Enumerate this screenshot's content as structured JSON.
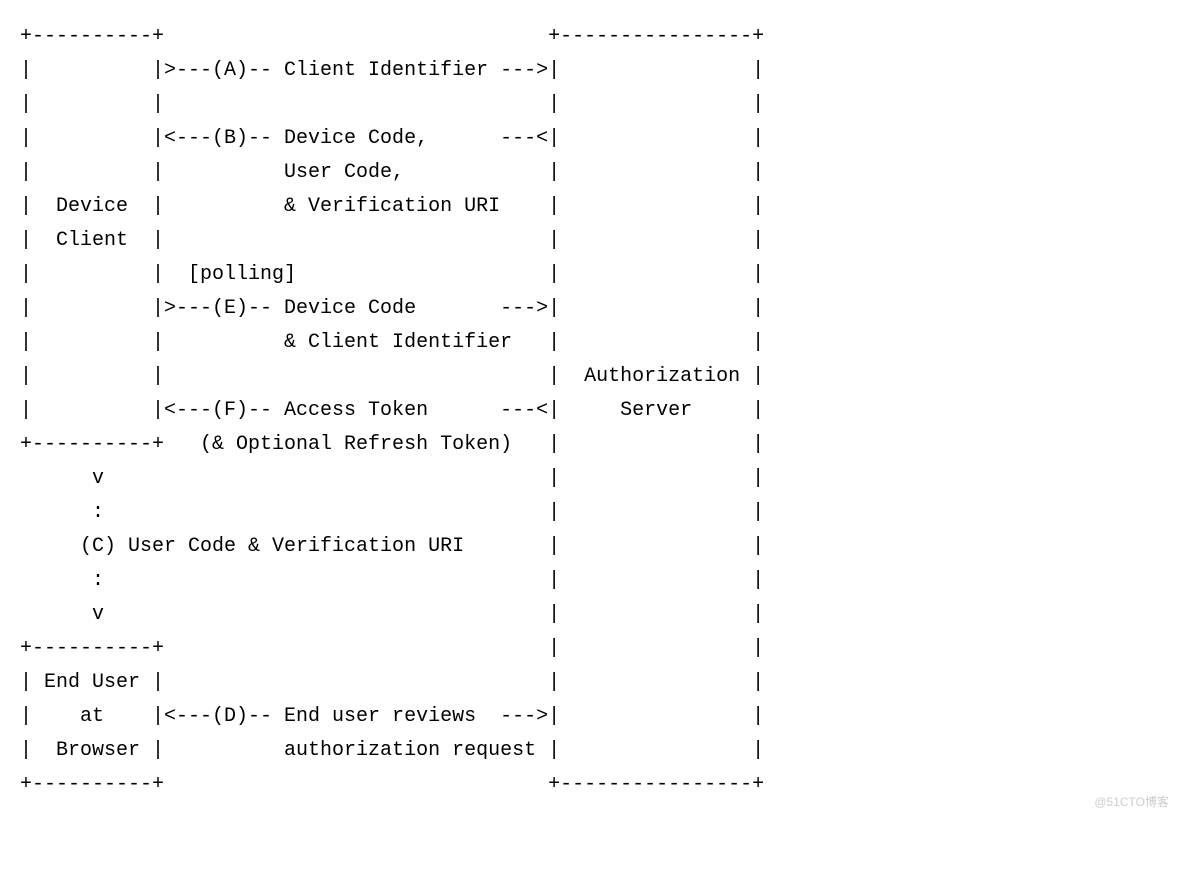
{
  "diagram": {
    "lines": [
      "+----------+                                +----------------+",
      "|          |>---(A)-- Client Identifier --->|                |",
      "|          |                                |                |",
      "|          |<---(B)-- Device Code,      ---<|                |",
      "|          |          User Code,            |                |",
      "|  Device  |          & Verification URI    |                |",
      "|  Client  |                                |                |",
      "|          |  [polling]                     |                |",
      "|          |>---(E)-- Device Code       --->|                |",
      "|          |          & Client Identifier   |                |",
      "|          |                                |  Authorization |",
      "|          |<---(F)-- Access Token      ---<|     Server     |",
      "+----------+   (& Optional Refresh Token)   |                |",
      "      v                                     |                |",
      "      :                                     |                |",
      "     (C) User Code & Verification URI       |                |",
      "      :                                     |                |",
      "      v                                     |                |",
      "+----------+                                |                |",
      "| End User |                                |                |",
      "|    at    |<---(D)-- End user reviews  --->|                |",
      "|  Browser |          authorization request |                |",
      "+----------+                                +----------------+"
    ]
  },
  "watermark": "@51CTO博客"
}
